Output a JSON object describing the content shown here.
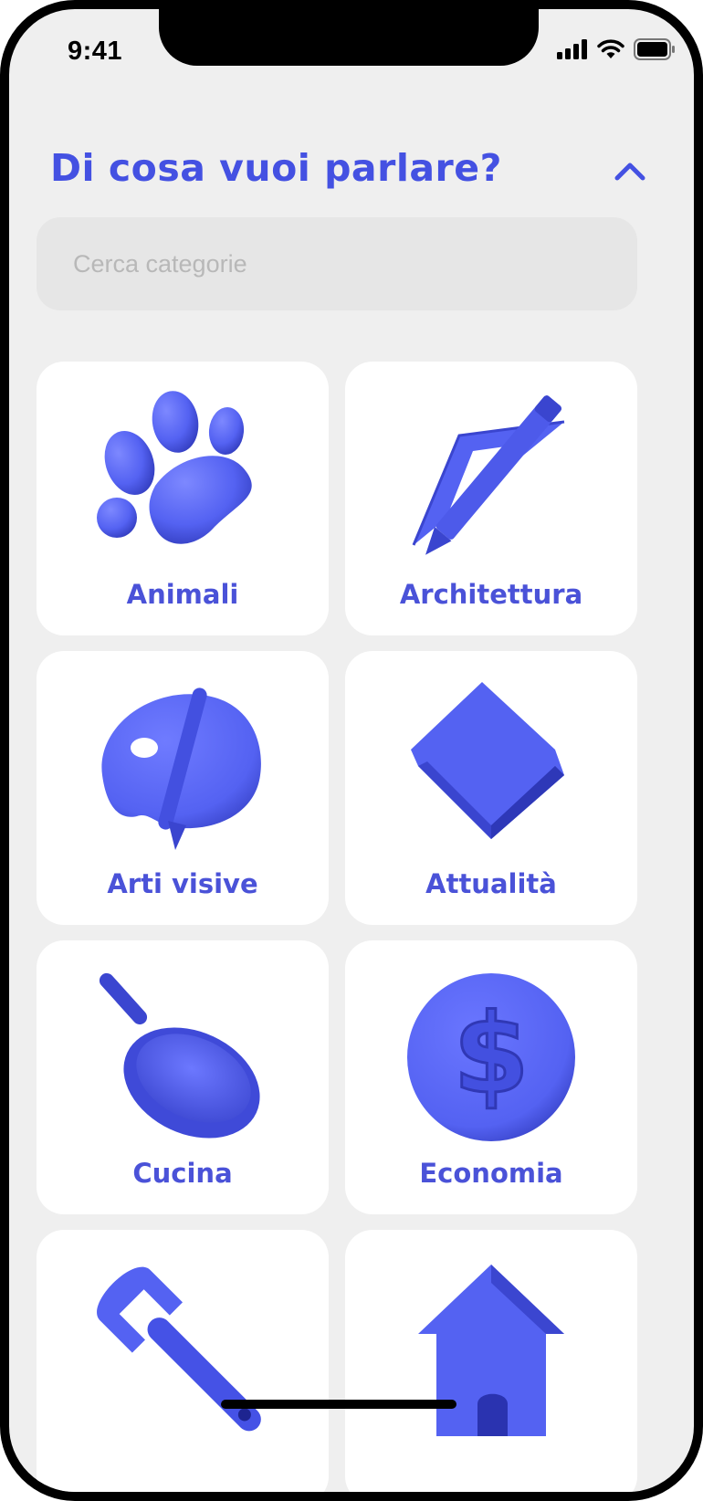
{
  "status": {
    "time": "9:41"
  },
  "header": {
    "title": "Di cosa vuoi parlare?",
    "collapse_icon": "chevron-up-icon"
  },
  "search": {
    "placeholder": "Cerca categorie",
    "value": ""
  },
  "categories": [
    {
      "label": "Animali",
      "icon": "paw-icon"
    },
    {
      "label": "Architettura",
      "icon": "set-square-pencil-icon"
    },
    {
      "label": "Arti visive",
      "icon": "palette-icon"
    },
    {
      "label": "Attualità",
      "icon": "newspaper-icon"
    },
    {
      "label": "Cucina",
      "icon": "frying-pan-icon"
    },
    {
      "label": "Economia",
      "icon": "dollar-coin-icon"
    },
    {
      "label": "",
      "icon": "wrench-icon"
    },
    {
      "label": "",
      "icon": "house-icon"
    }
  ],
  "colors": {
    "accent": "#4451e2",
    "icon_fill": "#5462f2",
    "background": "#efefef",
    "card": "#ffffff"
  }
}
